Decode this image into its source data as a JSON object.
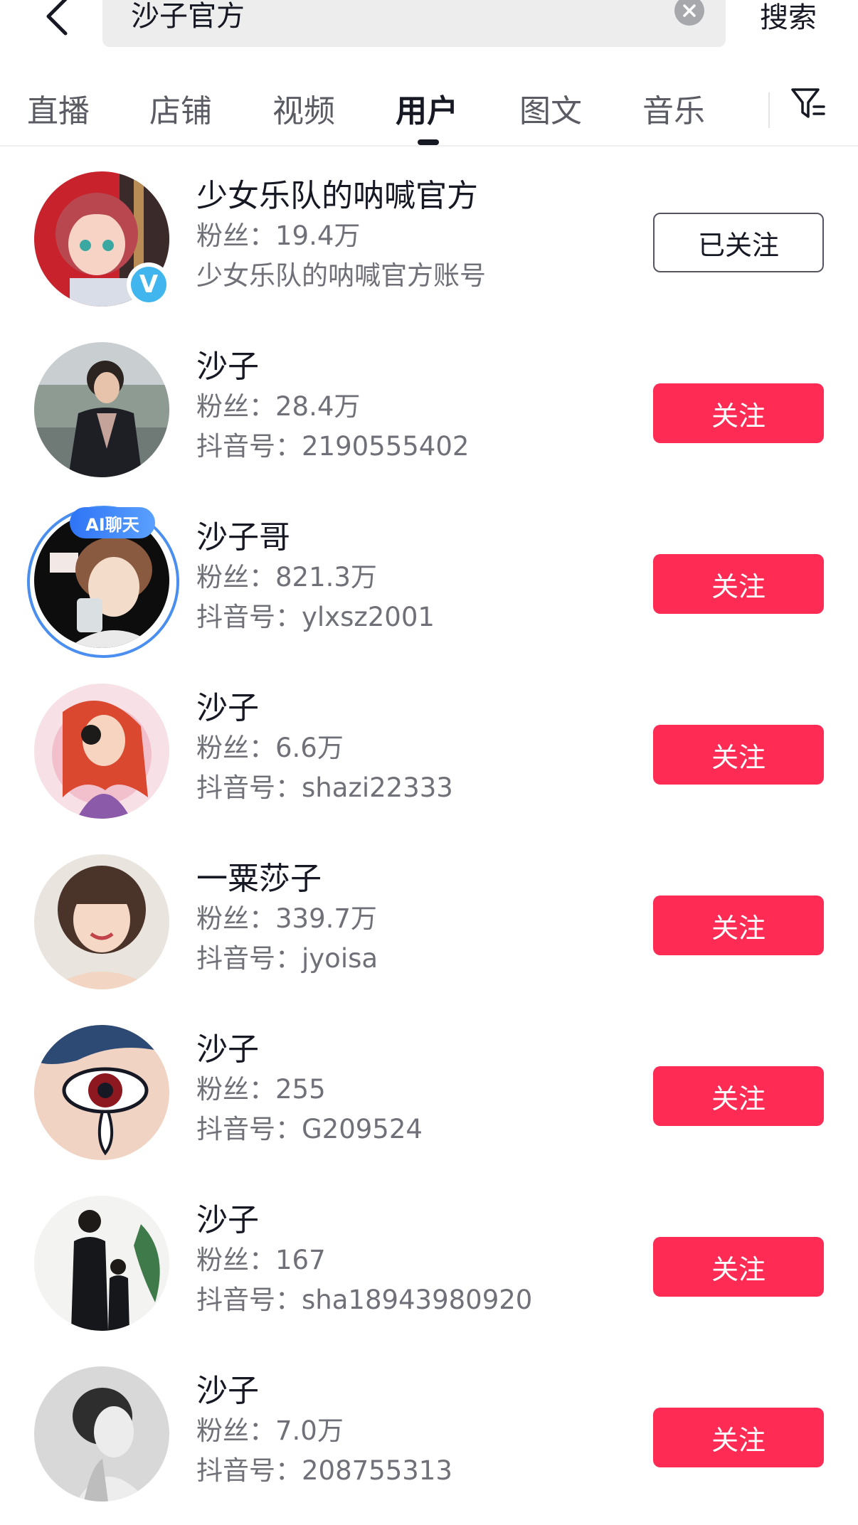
{
  "search": {
    "query": "沙子官方",
    "submit_label": "搜索"
  },
  "tabs": [
    {
      "label": "直播",
      "active": false
    },
    {
      "label": "店铺",
      "active": false
    },
    {
      "label": "视频",
      "active": false
    },
    {
      "label": "用户",
      "active": true
    },
    {
      "label": "图文",
      "active": false
    },
    {
      "label": "音乐",
      "active": false
    }
  ],
  "colors": {
    "follow_button": "#fe2c55",
    "ai_badge": "#2f74f5",
    "verified_badge": "#41b6ee"
  },
  "users": [
    {
      "name": "少女乐队的呐喊官方",
      "fans": "粉丝：19.4万",
      "detail": "少女乐队的呐喊官方账号",
      "button": "已关注",
      "followed": true,
      "verified_badge": "V",
      "avatar": "anime-girl-guitar"
    },
    {
      "name": "沙子",
      "fans": "粉丝：28.4万",
      "detail": "抖音号：2190555402",
      "button": "关注",
      "followed": false,
      "avatar": "woman-dark-suit"
    },
    {
      "name": "沙子哥",
      "fans": "粉丝：821.3万",
      "detail": "抖音号：ylxsz2001",
      "button": "关注",
      "followed": false,
      "ai_badge": "AI聊天",
      "avatar": "anime-boy-cup"
    },
    {
      "name": "沙子",
      "fans": "粉丝：6.6万",
      "detail": "抖音号：shazi22333",
      "button": "关注",
      "followed": false,
      "avatar": "cartoon-woman-camera"
    },
    {
      "name": "一粟莎子",
      "fans": "粉丝：339.7万",
      "detail": "抖音号：jyoisa",
      "button": "关注",
      "followed": false,
      "avatar": "smiling-girl"
    },
    {
      "name": "沙子",
      "fans": "粉丝：255",
      "detail": "抖音号：G209524",
      "button": "关注",
      "followed": false,
      "avatar": "crying-eye-comic"
    },
    {
      "name": "沙子",
      "fans": "粉丝：167",
      "detail": "抖音号：sha18943980920",
      "button": "关注",
      "followed": false,
      "avatar": "man-and-boy-suits"
    },
    {
      "name": "沙子",
      "fans": "粉丝：7.0万",
      "detail": "抖音号：208755313",
      "button": "关注",
      "followed": false,
      "avatar": "grayscale-woman-profile"
    }
  ]
}
